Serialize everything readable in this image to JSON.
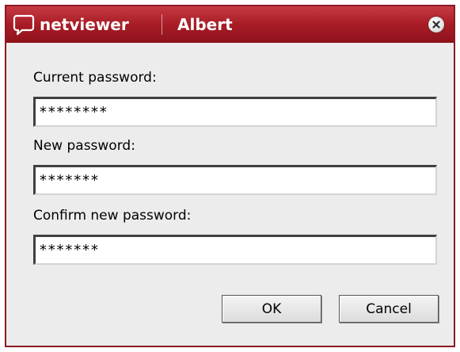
{
  "titlebar": {
    "brand": "netviewer",
    "title": "Albert",
    "close_icon": "close-icon"
  },
  "form": {
    "current_password": {
      "label": "Current password:",
      "value": "********"
    },
    "new_password": {
      "label": "New password:",
      "value": "*******"
    },
    "confirm_password": {
      "label": "Confirm new password:",
      "value": "*******"
    }
  },
  "buttons": {
    "ok": "OK",
    "cancel": "Cancel"
  },
  "colors": {
    "titlebar_red": "#a81c26",
    "window_bg": "#ececec"
  }
}
